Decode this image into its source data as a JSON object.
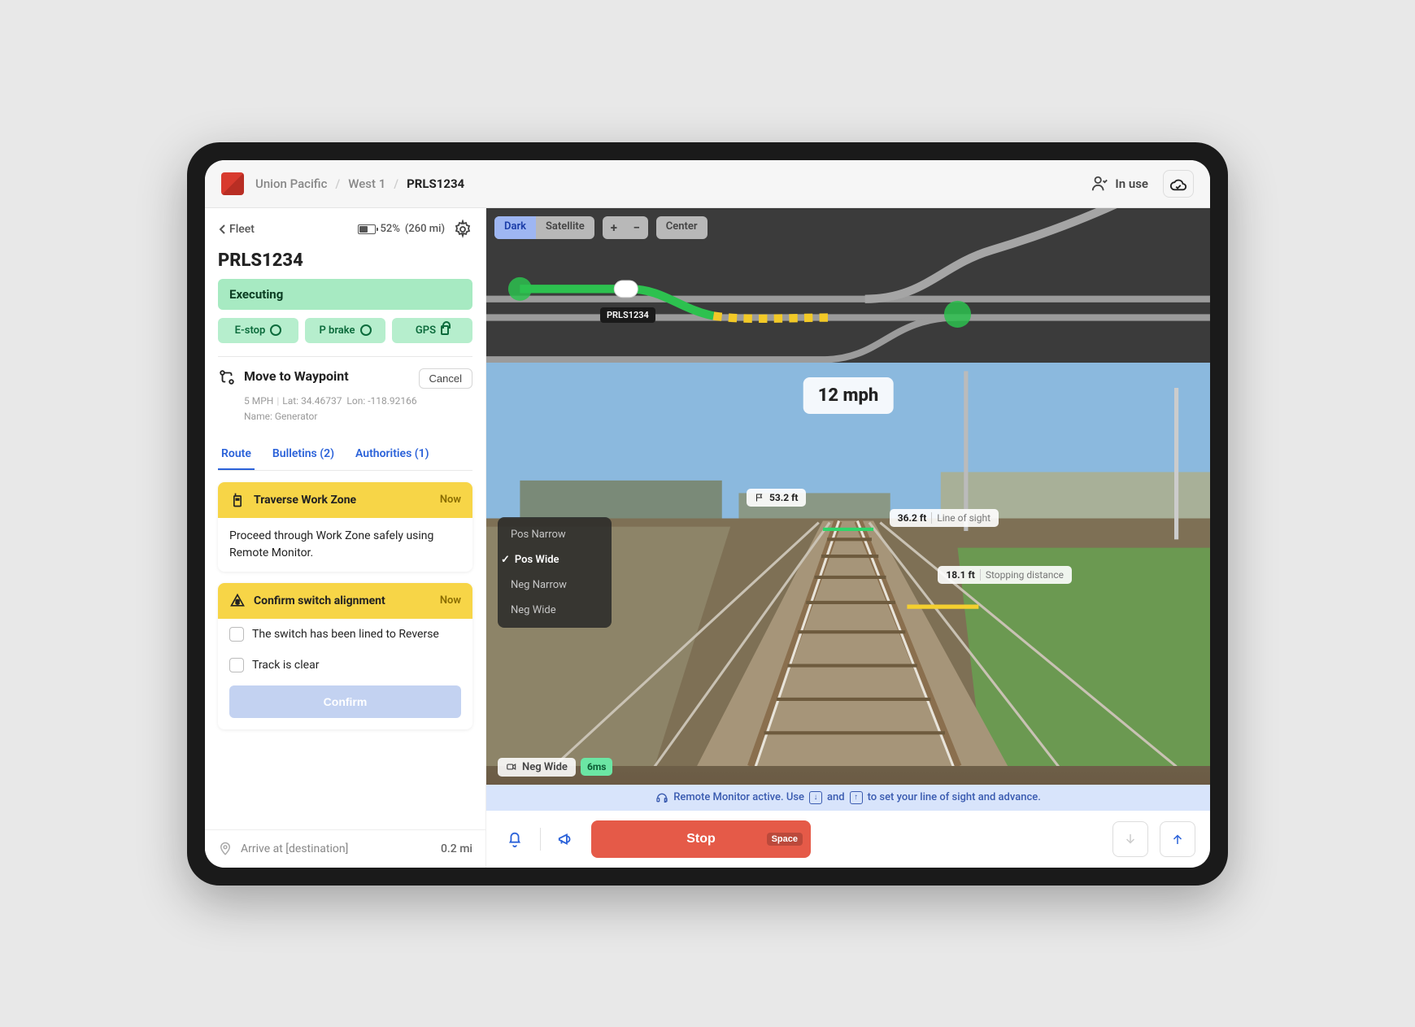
{
  "header": {
    "breadcrumb": [
      "Union Pacific",
      "West 1",
      "PRLS1234"
    ],
    "status_label": "In use"
  },
  "sidebar": {
    "back_label": "Fleet",
    "battery_pct": "52%",
    "battery_range": "(260 mi)",
    "unit_id": "PRLS1234",
    "status": "Executing",
    "pills": [
      {
        "label": "E-stop",
        "icon": "ring"
      },
      {
        "label": "P brake",
        "icon": "ring"
      },
      {
        "label": "GPS",
        "icon": "lock"
      }
    ],
    "waypoint": {
      "title": "Move to Waypoint",
      "cancel": "Cancel",
      "speed": "5 MPH",
      "lat": "Lat: 34.46737",
      "lon": "Lon: -118.92166",
      "name": "Name: Generator"
    },
    "tabs": [
      {
        "label": "Route",
        "active": true
      },
      {
        "label": "Bulletins (2)",
        "active": false
      },
      {
        "label": "Authorities (1)",
        "active": false
      }
    ],
    "cards": [
      {
        "icon": "walkie",
        "title": "Traverse Work Zone",
        "now": "Now",
        "body": "Proceed through Work Zone safely using Remote Monitor."
      },
      {
        "icon": "warn",
        "title": "Confirm switch alignment",
        "now": "Now",
        "checks": [
          "The switch has been lined to Reverse",
          "Track is clear"
        ],
        "confirm": "Confirm"
      }
    ],
    "footer": {
      "label": "Arrive at [destination]",
      "distance": "0.2 mi"
    }
  },
  "map": {
    "view_toggle": [
      "Dark",
      "Satellite"
    ],
    "zoom": [
      "+",
      "−"
    ],
    "center": "Center",
    "train_label": "PRLS1234"
  },
  "camera": {
    "speed": "12 mph",
    "menu": [
      "Pos Narrow",
      "Pos Wide",
      "Neg Narrow",
      "Neg Wide"
    ],
    "menu_selected": "Pos Wide",
    "mode_label": "Neg Wide",
    "ping": "6ms",
    "overlays": {
      "flag": "53.2 ft",
      "los_val": "36.2 ft",
      "los_lbl": "Line of sight",
      "stop_val": "18.1 ft",
      "stop_lbl": "Stopping distance"
    }
  },
  "banner": {
    "text_pre": "Remote Monitor active. Use",
    "text_mid": "and",
    "text_post": "to set your line of sight and advance."
  },
  "bottom": {
    "stop": "Stop",
    "stop_key": "Space"
  }
}
